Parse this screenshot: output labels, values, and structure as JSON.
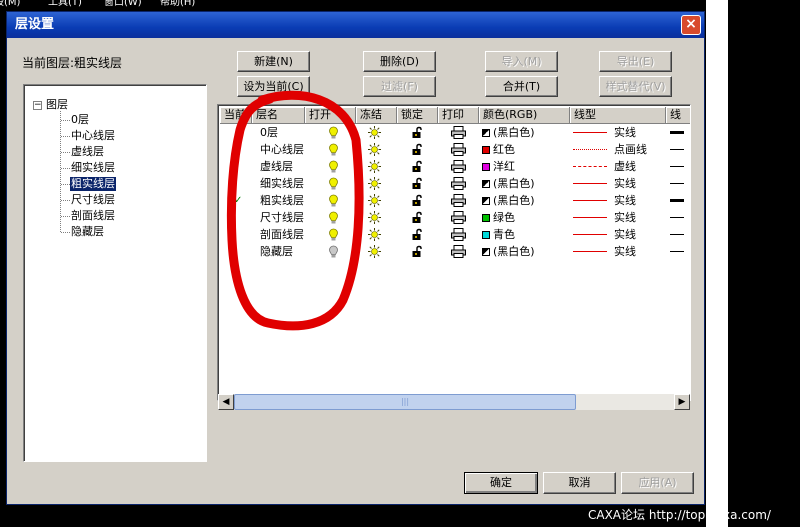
{
  "menubar": {
    "items": [
      "段(M)",
      "工具(T)",
      "窗口(W)",
      "帮助(H)"
    ]
  },
  "dialog": {
    "title": "层设置",
    "close_label": "×"
  },
  "current_layer": {
    "label": "当前图层:粗实线层"
  },
  "buttons": {
    "new": "新建(N)",
    "delete": "删除(D)",
    "import": "导入(M)",
    "export": "导出(E)",
    "set_current": "设为当前(C)",
    "filter": "过滤(F)",
    "merge": "合并(T)",
    "style_replace": "样式替代(V)",
    "ok": "确定",
    "cancel": "取消",
    "apply": "应用(A)"
  },
  "tree": {
    "root": "图层",
    "expand_glyph": "−",
    "items": [
      "0层",
      "中心线层",
      "虚线层",
      "细实线层",
      "粗实线层",
      "尺寸线层",
      "剖面线层",
      "隐藏层"
    ],
    "selected_index": 4
  },
  "table": {
    "headers": [
      "当前",
      "层名",
      "打开",
      "冻结",
      "锁定",
      "打印",
      "颜色(RGB)",
      "线型",
      "线"
    ],
    "rows": [
      {
        "name": "0层",
        "current": false,
        "on": true,
        "color": "(黑白色)",
        "swatch": "bw",
        "linetype": "实线",
        "pattern": "solid",
        "weight": "thick"
      },
      {
        "name": "中心线层",
        "current": false,
        "on": true,
        "color": "红色",
        "swatch": "#e00000",
        "linetype": "点画线",
        "pattern": "dashdot",
        "weight": "thin"
      },
      {
        "name": "虚线层",
        "current": false,
        "on": true,
        "color": "洋红",
        "swatch": "#e000e0",
        "linetype": "虚线",
        "pattern": "dash",
        "weight": "thin"
      },
      {
        "name": "细实线层",
        "current": false,
        "on": true,
        "color": "(黑白色)",
        "swatch": "bw",
        "linetype": "实线",
        "pattern": "solid",
        "weight": "thin"
      },
      {
        "name": "粗实线层",
        "current": true,
        "on": true,
        "color": "(黑白色)",
        "swatch": "bw",
        "linetype": "实线",
        "pattern": "solid",
        "weight": "thick"
      },
      {
        "name": "尺寸线层",
        "current": false,
        "on": true,
        "color": "绿色",
        "swatch": "#00c000",
        "linetype": "实线",
        "pattern": "solid",
        "weight": "thin"
      },
      {
        "name": "剖面线层",
        "current": false,
        "on": true,
        "color": "青色",
        "swatch": "#00d8d8",
        "linetype": "实线",
        "pattern": "solid",
        "weight": "thin"
      },
      {
        "name": "隐藏层",
        "current": false,
        "on": false,
        "color": "(黑白色)",
        "swatch": "bw",
        "linetype": "实线",
        "pattern": "solid",
        "weight": "thin"
      }
    ]
  },
  "scrollbar": {
    "thumb_glyph": "|||"
  },
  "colors": {
    "annotation_red": "#e00000",
    "title_blue": "#0a3cb4",
    "selection": "#0a246a"
  },
  "watermark": "CAXA论坛 http://top.caxa.com/"
}
